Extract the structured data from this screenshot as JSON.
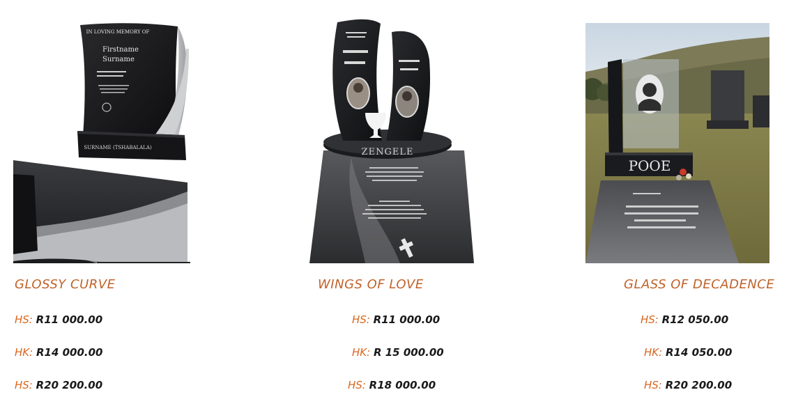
{
  "products": [
    {
      "name": "GLOSSY CURVE",
      "photo_alt": "Glossy Curve tombstone",
      "photo_text": {
        "memory_line": "IN LOVING MEMORY OF",
        "first_name": "Firstname",
        "surname": "Surname",
        "base_name": "SURNAME (TSHABALALA)"
      },
      "prices": [
        {
          "label": "HS:",
          "value": "R11 000.00"
        },
        {
          "label": "HK:",
          "value": "R14 000.00"
        },
        {
          "label": "HS:",
          "value": "R20 200.00"
        }
      ]
    },
    {
      "name": "WINGS OF LOVE",
      "photo_alt": "Wings of Love tombstone",
      "photo_text": {
        "base_name": "ZENGELE"
      },
      "prices": [
        {
          "label": "HS:",
          "value": "R11 000.00"
        },
        {
          "label": "HK:",
          "value": "R 15 000.00"
        },
        {
          "label": "HS:",
          "value": "R18 000.00"
        }
      ]
    },
    {
      "name": "GLASS OF DECADENCE",
      "photo_alt": "Glass of Decadence tombstone",
      "photo_text": {
        "base_name": "POOE"
      },
      "prices": [
        {
          "label": "HS:",
          "value": "R12 050.00"
        },
        {
          "label": "HK:",
          "value": "R14 050.00"
        },
        {
          "label": "HS:",
          "value": "R20 200.00"
        }
      ]
    }
  ],
  "colors": {
    "accent": "#d9661e",
    "title": "#c0622a",
    "value_text": "#1a1a1a",
    "granite": "#1c1c1e"
  }
}
